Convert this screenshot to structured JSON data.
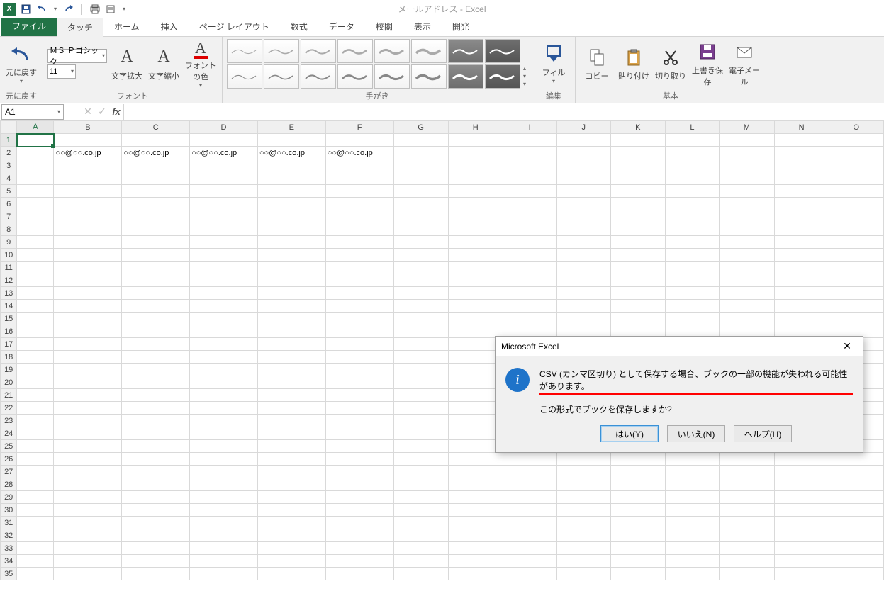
{
  "app": {
    "title": "メールアドレス - Excel"
  },
  "tabs": {
    "file": "ファイル",
    "touch": "タッチ",
    "home": "ホーム",
    "insert": "挿入",
    "pageLayout": "ページ レイアウト",
    "formulas": "数式",
    "data": "データ",
    "review": "校閲",
    "view": "表示",
    "developer": "開発"
  },
  "ribbon": {
    "undoGroup": {
      "undo": "元に戻す",
      "label": "元に戻す"
    },
    "fontGroup": {
      "fontName": "ＭＳ Ｐゴシック",
      "fontSize": "11",
      "enlarge": "文字拡大",
      "shrink": "文字縮小",
      "fontColor": "フォントの色",
      "label": "フォント"
    },
    "inkGroup": {
      "label": "手がき"
    },
    "editGroup": {
      "fill": "フィル",
      "label": "編集"
    },
    "basicGroup": {
      "copy": "コピー",
      "paste": "貼り付け",
      "cut": "切り取り",
      "save": "上書き保存",
      "email": "電子メール",
      "label": "基本"
    }
  },
  "nameBox": "A1",
  "columns": [
    "A",
    "B",
    "C",
    "D",
    "E",
    "F",
    "G",
    "H",
    "I",
    "J",
    "K",
    "L",
    "M",
    "N",
    "O"
  ],
  "rowCount": 35,
  "selectedCell": {
    "row": 1,
    "col": 0
  },
  "dataRow": {
    "row": 2,
    "cells": {
      "B": "○○@○○.co.jp",
      "C": "○○@○○.co.jp",
      "D": "○○@○○.co.jp",
      "E": "○○@○○.co.jp",
      "F": "○○@○○.co.jp"
    }
  },
  "dialog": {
    "title": "Microsoft Excel",
    "message1": "CSV (カンマ区切り) として保存する場合、ブックの一部の機能が失われる可能性があります。",
    "message2": "この形式でブックを保存しますか?",
    "yes": "はい(Y)",
    "no": "いいえ(N)",
    "help": "ヘルプ(H)"
  }
}
